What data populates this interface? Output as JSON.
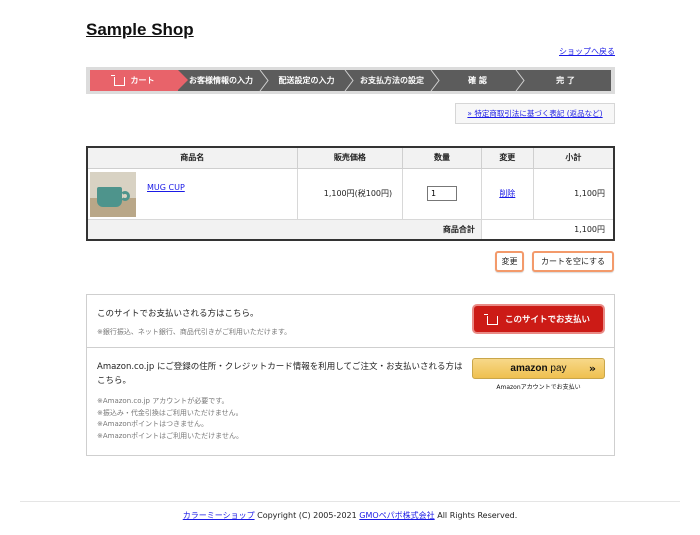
{
  "shop": {
    "title": "Sample Shop",
    "back_link": "ショップへ戻る"
  },
  "steps": [
    {
      "label": "カート",
      "active": true
    },
    {
      "label": "お客様情報の入力",
      "active": false
    },
    {
      "label": "配送設定の入力",
      "active": false
    },
    {
      "label": "お支払方法の設定",
      "active": false
    },
    {
      "label": "確 認",
      "active": false
    },
    {
      "label": "完 了",
      "active": false
    }
  ],
  "tokutei_link": "» 特定商取引法に基づく表記 (返品など)",
  "table": {
    "headers": [
      "商品名",
      "販売価格",
      "数量",
      "変更",
      "小計"
    ],
    "item": {
      "name": "MUG CUP",
      "price": "1,100円(税100円)",
      "quantity": "1",
      "delete_label": "削除",
      "subtotal": "1,100円",
      "thumbnail_icon": "mug-photo"
    },
    "total_label": "商品合計",
    "total_value": "1,100円"
  },
  "buttons": {
    "change": "変更",
    "empty_cart": "カートを空にする"
  },
  "payment": {
    "site_title": "このサイトでお支払いされる方はこちら。",
    "site_note": "※銀行振込、ネット銀行、商品代引きがご利用いただけます。",
    "site_button": "このサイトでお支払い",
    "amazon_text": "Amazon.co.jp にご登録の住所・クレジットカード情報を利用してご注文・お支払いされる方はこちら。",
    "amazon_notes": [
      "※Amazon.co.jp アカウントが必要です。",
      "※振込み・代金引換はご利用いただけません。",
      "※Amazonポイントはつきません。",
      "※Amazonポイントはご利用いただけません。"
    ],
    "amazon_logo_bold": "amazon",
    "amazon_logo_rest": " pay",
    "amazon_arrows": "»",
    "amazon_caption": "Amazonアカウントでお支払い"
  },
  "footer": {
    "link1": "カラーミーショップ",
    "copyright": " Copyright (C) 2005-2021 ",
    "link2": "GMOペパボ株式会社",
    "rights": " All Rights Reserved."
  },
  "colors": {
    "active_step": "#e8636a",
    "inactive_step": "#5c5c5c",
    "pay_button": "#cc1b16",
    "accent_border": "#f39a6b",
    "link": "#1a1ae6"
  }
}
